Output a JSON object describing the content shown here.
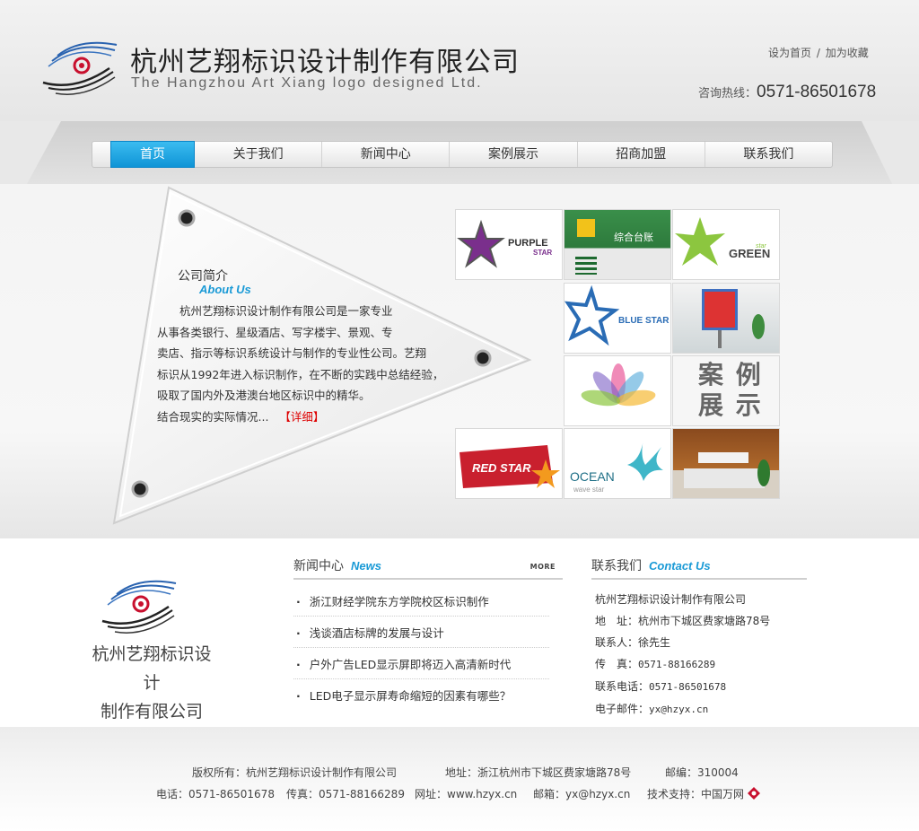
{
  "header": {
    "company_cn": "杭州艺翔标识设计制作有限公司",
    "company_en": "The Hangzhou Art Xiang logo designed Ltd.",
    "set_home": "设为首页",
    "separator": "/",
    "add_favorite": "加为收藏",
    "hotline_label": "咨询热线：",
    "hotline_number": "0571-86501678"
  },
  "nav": {
    "items": [
      "首页",
      "关于我们",
      "新闻中心",
      "案例展示",
      "招商加盟",
      "联系我们"
    ],
    "active_index": 0
  },
  "about": {
    "title": "公司简介",
    "title_en": "About Us",
    "lines": [
      "　　杭州艺翔标识设计制作有限公司是一家专业",
      "从事各类银行、星级酒店、写字楼宇、景观、专",
      "卖店、指示等标识系统设计与制作的专业性公司。艺翔",
      "标识从1992年进入标识制作，在不断的实践中总结经验，",
      "吸取了国内外及港澳台地区标识中的精华。",
      "结合现实的实际情况..."
    ],
    "more": "【详细】"
  },
  "cases": {
    "tiles": [
      {
        "label_main": "PURPLE",
        "label_sub": "STAR"
      },
      {
        "label_main": "综合台账",
        "label_sub": ""
      },
      {
        "label_main": "GREEN",
        "label_sub": "star"
      },
      {
        "label_main": "BLUE STAR",
        "label_sub": ""
      },
      {
        "label_main": "",
        "label_sub": ""
      },
      {
        "label_main": "",
        "label_sub": ""
      },
      {
        "label_main": "案 例",
        "label_sub": "展 示"
      },
      {
        "label_main": "RED STAR",
        "label_sub": ""
      },
      {
        "label_main": "OCEAN",
        "label_sub": "wave star"
      },
      {
        "label_main": "",
        "label_sub": ""
      }
    ]
  },
  "bottom_logo": {
    "line1": "杭州艺翔标识设计",
    "line2": "制作有限公司"
  },
  "news": {
    "title": "新闻中心",
    "title_en": "News",
    "more": "MORE",
    "items": [
      "浙江财经学院东方学院校区标识制作",
      "浅谈酒店标牌的发展与设计",
      "户外广告LED显示屏即将迈入高清新时代",
      "LED电子显示屏寿命缩短的因素有哪些？"
    ]
  },
  "contact": {
    "title": "联系我们",
    "title_en": "Contact Us",
    "company": "杭州艺翔标识设计制作有限公司",
    "address_label": "地　址：",
    "address": "杭州市下城区费家塘路78号",
    "person_label": "联系人：",
    "person": "徐先生",
    "fax_label": "传　真：",
    "fax": "0571-88166289",
    "phone_label": "联系电话：",
    "phone": "0571-86501678",
    "email_label": "电子邮件：",
    "email": "yx@hzyx.cn"
  },
  "footer": {
    "copyright": "版权所有：杭州艺翔标识设计制作有限公司",
    "address": "地址：浙江杭州市下城区费家塘路78号",
    "postcode": "邮编：310004",
    "phone": "电话：0571-86501678",
    "fax": "传真：0571-88166289",
    "website": "网址：www.hzyx.cn",
    "email": "邮箱：yx@hzyx.cn",
    "support": "技术支持：中国万网"
  },
  "colors": {
    "accent_blue": "#1a9ad6",
    "nav_active": "#12a0e0",
    "more_red": "#dd0000"
  }
}
